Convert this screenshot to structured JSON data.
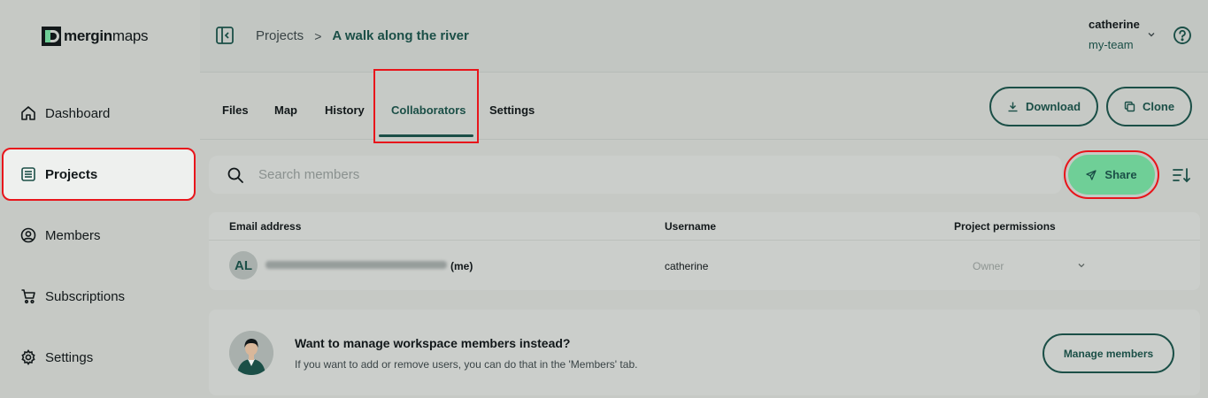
{
  "app": {
    "logo_bold": "mergin",
    "logo_light": "maps"
  },
  "sidebar": {
    "items": [
      {
        "label": "Dashboard",
        "icon": "home-icon"
      },
      {
        "label": "Projects",
        "icon": "projects-list-icon",
        "active": true
      },
      {
        "label": "Members",
        "icon": "user-circle-icon"
      },
      {
        "label": "Subscriptions",
        "icon": "cart-icon"
      },
      {
        "label": "Settings",
        "icon": "gear-icon"
      }
    ]
  },
  "header": {
    "breadcrumb_root": "Projects",
    "breadcrumb_separator": ">",
    "breadcrumb_current": "A walk along the river",
    "user_name": "catherine",
    "workspace": "my-team"
  },
  "tabs": {
    "items": [
      "Files",
      "Map",
      "History",
      "Collaborators",
      "Settings"
    ],
    "active": "Collaborators"
  },
  "actions": {
    "download_label": "Download",
    "clone_label": "Clone",
    "share_label": "Share"
  },
  "search": {
    "placeholder": "Search members",
    "value": ""
  },
  "table": {
    "columns": [
      "Email address",
      "Username",
      "Project permissions"
    ],
    "rows": [
      {
        "avatar_initials": "AL",
        "email_suffix": "(me)",
        "username": "catherine",
        "permission": "Owner"
      }
    ]
  },
  "info_card": {
    "title": "Want to manage workspace members instead?",
    "text": "If you want to add or remove users, you can do that in the 'Members' tab.",
    "button_label": "Manage members"
  },
  "colors": {
    "brand_dark": "#1b4f47",
    "brand_green": "#6fcf97",
    "highlight_red": "#e8151b"
  }
}
